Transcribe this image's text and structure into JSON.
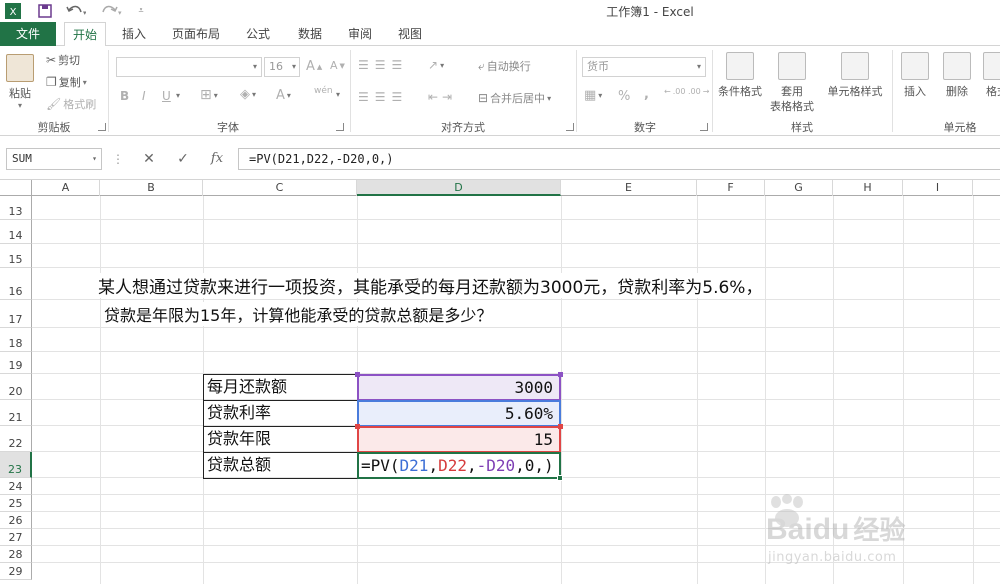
{
  "window": {
    "title": "工作簿1 - Excel"
  },
  "tabs": [
    "文件",
    "开始",
    "插入",
    "页面布局",
    "公式",
    "数据",
    "审阅",
    "视图"
  ],
  "ribbon": {
    "clipboard": {
      "paste": "粘贴",
      "cut": "剪切",
      "copy": "复制",
      "format_painter": "格式刷",
      "label": "剪贴板"
    },
    "font": {
      "size": "16",
      "bold": "B",
      "italic": "I",
      "underline": "U",
      "grow": "A",
      "shrink": "A",
      "font_color": "A",
      "phonetic": "wén",
      "label": "字体"
    },
    "alignment": {
      "wrap": "自动换行",
      "merge": "合并后居中",
      "label": "对齐方式"
    },
    "number": {
      "format": "货币",
      "percent": "%",
      "comma": ",",
      "inc_dec": ".00",
      "dec_dec": ".00",
      "label": "数字"
    },
    "styles": {
      "conditional": "条件格式",
      "table_top": "套用",
      "table_bottom": "表格格式",
      "cell_styles": "单元格样式",
      "label": "样式"
    },
    "cells": {
      "insert": "插入",
      "delete": "删除",
      "format": "格式",
      "label": "单元格"
    }
  },
  "formula_bar": {
    "name_box": "SUM",
    "cancel": "✕",
    "enter": "✓",
    "fx": "fx",
    "formula": "=PV(D21,D22,-D20,0,)"
  },
  "grid": {
    "columns": [
      "A",
      "B",
      "C",
      "D",
      "E",
      "F",
      "G",
      "H",
      "I"
    ],
    "rows": [
      "13",
      "14",
      "15",
      "16",
      "17",
      "18",
      "19",
      "20",
      "21",
      "22",
      "23",
      "24",
      "25",
      "26",
      "27",
      "28",
      "29"
    ],
    "line1": "某人想通过贷款来进行一项投资，其能承受的每月还款额为3000元，贷款利率为5.6%，",
    "line2": "贷款是年限为15年，计算他能承受的贷款总额是多少？",
    "table": [
      {
        "label": "每月还款额",
        "value": "3000",
        "color": "#7e3fb5"
      },
      {
        "label": "贷款利率",
        "value": "5.60%",
        "color": "#3d6fd6"
      },
      {
        "label": "贷款年限",
        "value": "15",
        "color": "#d63c3c"
      },
      {
        "label": "贷款总额",
        "value": ""
      }
    ],
    "edit_formula": {
      "prefix": "=PV(",
      "ref1": "D21",
      "sep1": ",",
      "ref2": "D22",
      "sep2": ",",
      "ref3": "-D20",
      "rest": ",0,)"
    }
  },
  "watermark": {
    "brand": "Bai",
    "brand2": "du",
    "text": "经验",
    "url": "jingyan.baidu.com"
  }
}
